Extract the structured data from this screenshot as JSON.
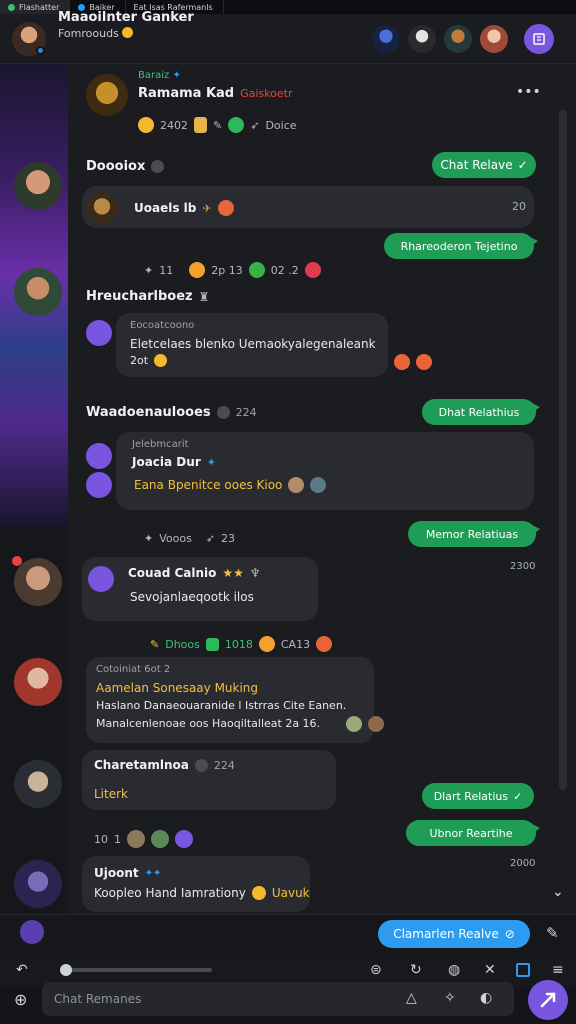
{
  "tabs": [
    "Flashatter",
    "Baiker",
    "Eat Isas Rafermanls"
  ],
  "header": {
    "title": "Maaoilnter Ganker",
    "subtitle": "Fomroouds"
  },
  "messages": {
    "m1": {
      "tag": "Baraiz",
      "name": "Ramama Kad",
      "extra": "Gaiskoetr",
      "reacts": [
        "2402",
        "Doice"
      ]
    },
    "m2": {
      "name": "Doooiox",
      "button": "Chat Relave"
    },
    "m3": {
      "text": "Uoaels lb",
      "time": "20"
    },
    "m4": {
      "button": "Rhareoderon Tejetino"
    },
    "m5": {
      "reacts": [
        "11",
        "2p 13",
        "02 .2"
      ]
    },
    "m6": {
      "name": "Hreucharlboez"
    },
    "m7": {
      "header": "Eocoatcoono",
      "line1": "Eletcelaes blenko Uemaokyalegenaleank",
      "line2": "2ot"
    },
    "m8": {
      "name": "Waadoenaulooes",
      "count": "224",
      "button": "Dhat Relathius"
    },
    "m9": {
      "header": "Jelebmcarit",
      "name": "Joacia Dur",
      "line": "Eana Bpenitce ooes Kioo"
    },
    "m10": {
      "reacts": [
        "Vooos",
        "23"
      ],
      "button": "Memor Relatiuas"
    },
    "m11": {
      "name": "Couad Calnio",
      "text": "Sevojanlaeqootk ilos",
      "time": "2300"
    },
    "m12": {
      "reacts": [
        "Dhoos",
        "1018",
        "CA13"
      ]
    },
    "m13": {
      "header": "Cotoiniat",
      "sub": "6ot 2",
      "line1": "Aamelan Sonesaay Muking",
      "line2": "Haslano Danaeouaranide l Istrras Cite Eanen.",
      "line3": "Manalcenlenoae oos Haoqiltalleat 2a 16."
    },
    "m14": {
      "name": "Charetamlnoa",
      "count": "224",
      "text": "Literk",
      "button": "Dlart Relatius"
    },
    "m15": {
      "reacts": [
        "10",
        "1"
      ],
      "button": "Ubnor Reartihe"
    },
    "m16": {
      "name": "Ujoont",
      "text": "Koopleo Hand Iamrationy",
      "tail": "Uavuk",
      "time": "2000"
    }
  },
  "footer": {
    "blue_button": "Clamarlen Realve",
    "input_placeholder": "Chat Remanes"
  },
  "colors": {
    "accent_green": "#1f9d56",
    "accent_blue": "#2d9cf0",
    "accent_purple": "#7a55e0"
  }
}
